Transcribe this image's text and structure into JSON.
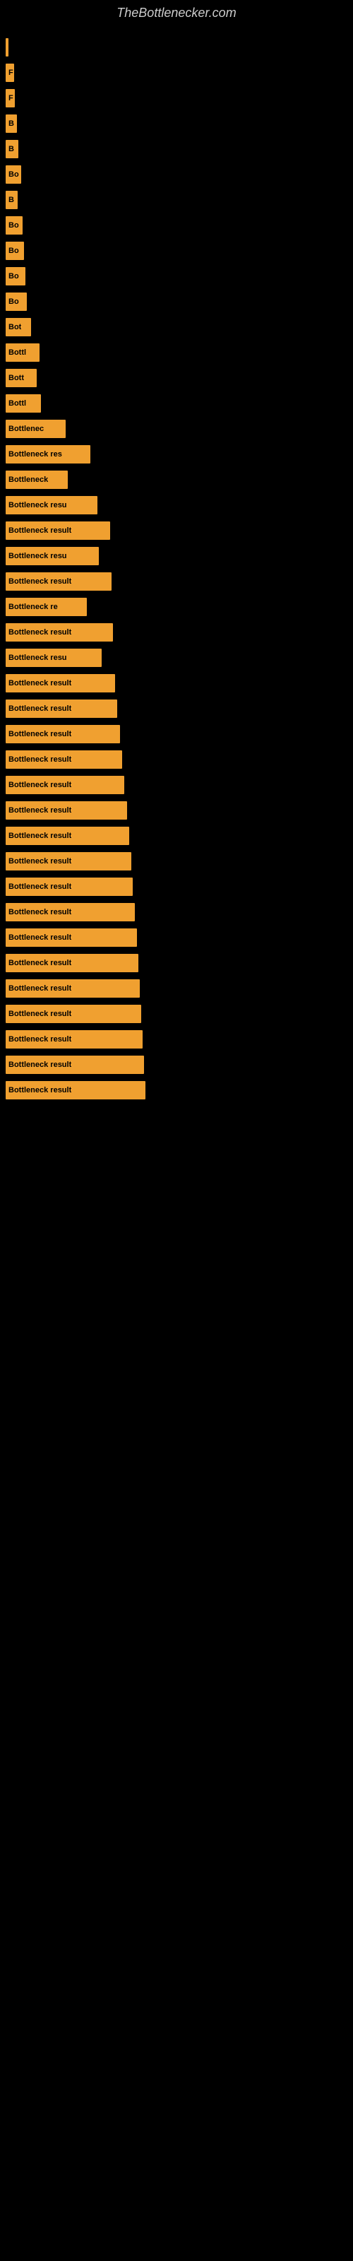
{
  "site": {
    "title": "TheBottlenecker.com"
  },
  "bars": [
    {
      "label": "",
      "width": 3
    },
    {
      "label": "F",
      "width": 12
    },
    {
      "label": "F",
      "width": 13
    },
    {
      "label": "B",
      "width": 16
    },
    {
      "label": "B",
      "width": 18
    },
    {
      "label": "Bo",
      "width": 22
    },
    {
      "label": "B",
      "width": 17
    },
    {
      "label": "Bo",
      "width": 24
    },
    {
      "label": "Bo",
      "width": 26
    },
    {
      "label": "Bo",
      "width": 28
    },
    {
      "label": "Bo",
      "width": 30
    },
    {
      "label": "Bot",
      "width": 36
    },
    {
      "label": "Bottl",
      "width": 48
    },
    {
      "label": "Bott",
      "width": 44
    },
    {
      "label": "Bottl",
      "width": 50
    },
    {
      "label": "Bottlenec",
      "width": 85
    },
    {
      "label": "Bottleneck res",
      "width": 120
    },
    {
      "label": "Bottleneck",
      "width": 88
    },
    {
      "label": "Bottleneck resu",
      "width": 130
    },
    {
      "label": "Bottleneck result",
      "width": 148
    },
    {
      "label": "Bottleneck resu",
      "width": 132
    },
    {
      "label": "Bottleneck result",
      "width": 150
    },
    {
      "label": "Bottleneck re",
      "width": 115
    },
    {
      "label": "Bottleneck result",
      "width": 152
    },
    {
      "label": "Bottleneck resu",
      "width": 136
    },
    {
      "label": "Bottleneck result",
      "width": 155
    },
    {
      "label": "Bottleneck result",
      "width": 158
    },
    {
      "label": "Bottleneck result",
      "width": 162
    },
    {
      "label": "Bottleneck result",
      "width": 165
    },
    {
      "label": "Bottleneck result",
      "width": 168
    },
    {
      "label": "Bottleneck result",
      "width": 172
    },
    {
      "label": "Bottleneck result",
      "width": 175
    },
    {
      "label": "Bottleneck result",
      "width": 178
    },
    {
      "label": "Bottleneck result",
      "width": 180
    },
    {
      "label": "Bottleneck result",
      "width": 183
    },
    {
      "label": "Bottleneck result",
      "width": 186
    },
    {
      "label": "Bottleneck result",
      "width": 188
    },
    {
      "label": "Bottleneck result",
      "width": 190
    },
    {
      "label": "Bottleneck result",
      "width": 192
    },
    {
      "label": "Bottleneck result",
      "width": 194
    },
    {
      "label": "Bottleneck result",
      "width": 196
    },
    {
      "label": "Bottleneck result",
      "width": 198
    }
  ]
}
